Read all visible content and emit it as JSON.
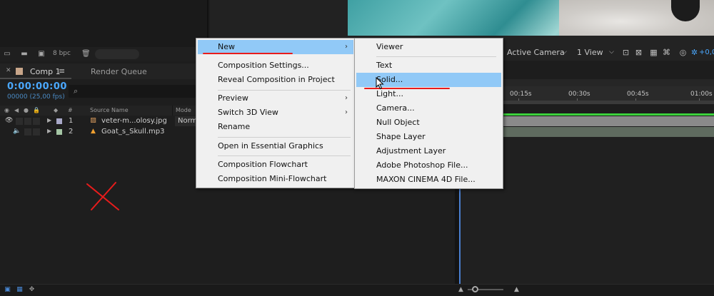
{
  "project_toolbar": {
    "bpc_label": "8 bpc"
  },
  "viewer_toolbar": {
    "camera_select": "Active Camera",
    "view_select": "1 View",
    "exposure_value": "+0,0"
  },
  "timeline": {
    "tabs": [
      {
        "label": "Comp 1",
        "swatch_color": "#c8a68a",
        "active": true
      },
      {
        "label": "Render Queue",
        "active": false
      }
    ],
    "timecode": "0:00:00:00",
    "fps_text": "00000 (25,00 fps)",
    "columns": {
      "number": "#",
      "source_name": "Source Name",
      "mode": "Mode"
    },
    "layers": [
      {
        "number": "1",
        "name": "veter-m...olosy.jpg",
        "label_color": "#a9a9c9",
        "mode": "Norm",
        "type": "image-icon"
      },
      {
        "number": "2",
        "name": "Goat_s_Skull.mp3",
        "label_color": "#a5c6a5",
        "type": "audio-icon"
      }
    ],
    "ruler": [
      "00:15s",
      "00:30s",
      "00:45s",
      "01:00s"
    ]
  },
  "context_menu": {
    "items": [
      {
        "label": "New",
        "has_submenu": true,
        "highlighted": true
      },
      {
        "label": "Composition Settings..."
      },
      {
        "label": "Reveal Composition in Project"
      },
      {
        "label": "Preview",
        "has_submenu": true
      },
      {
        "label": "Switch 3D View",
        "has_submenu": true
      },
      {
        "label": "Rename"
      },
      {
        "label": "Open in Essential Graphics"
      },
      {
        "label": "Composition Flowchart"
      },
      {
        "label": "Composition Mini-Flowchart"
      }
    ]
  },
  "submenu": {
    "items": [
      {
        "label": "Viewer"
      },
      {
        "label": "Text"
      },
      {
        "label": "Solid...",
        "highlighted": true
      },
      {
        "label": "Light..."
      },
      {
        "label": "Camera..."
      },
      {
        "label": "Null Object"
      },
      {
        "label": "Shape Layer"
      },
      {
        "label": "Adjustment Layer"
      },
      {
        "label": "Adobe Photoshop File..."
      },
      {
        "label": "MAXON CINEMA 4D File..."
      }
    ]
  },
  "colors": {
    "accent_blue": "#4aa8ff",
    "menu_highlight": "#91c9f7",
    "annotation_red": "#e81c1c",
    "timeline_green": "#3bd13b"
  }
}
